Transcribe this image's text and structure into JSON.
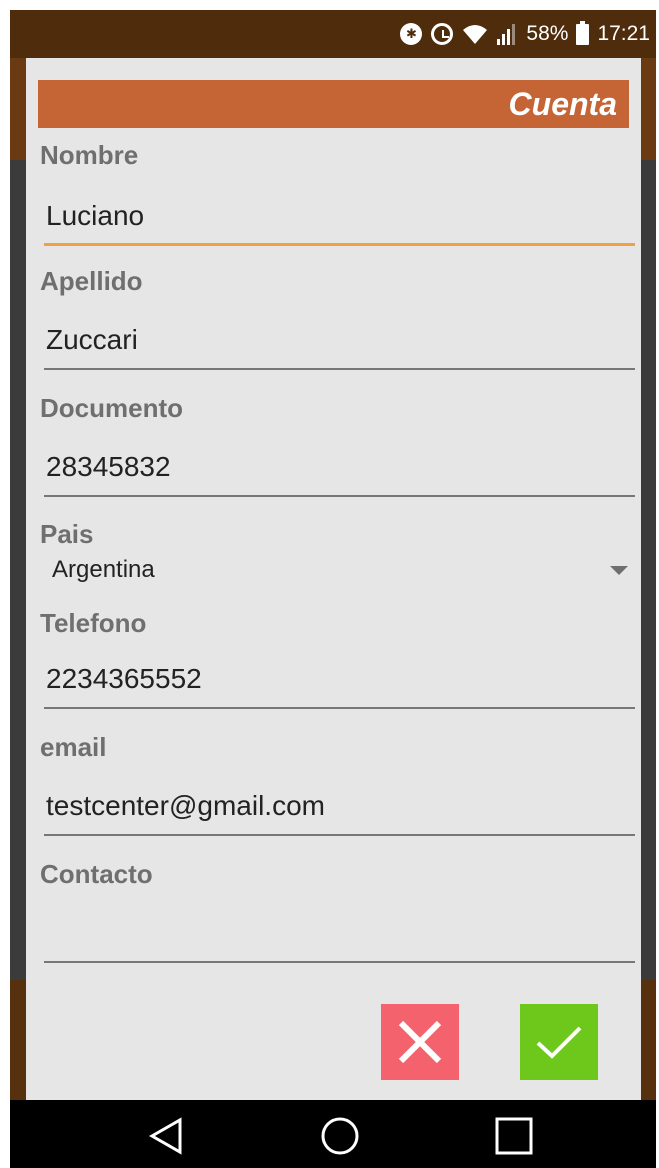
{
  "status_bar": {
    "icons": [
      "bluetooth-icon",
      "alarm-icon",
      "wifi-icon",
      "signal-icon",
      "battery-icon"
    ],
    "battery_percent": "58%",
    "time": "17:21"
  },
  "dialog": {
    "title": "Cuenta",
    "fields": {
      "nombre": {
        "label": "Nombre",
        "value": "Luciano"
      },
      "apellido": {
        "label": "Apellido",
        "value": "Zuccari"
      },
      "documento": {
        "label": "Documento",
        "value": "28345832"
      },
      "pais": {
        "label": "Pais",
        "value": "Argentina"
      },
      "telefono": {
        "label": "Telefono",
        "value": "2234365552"
      },
      "email": {
        "label": "email",
        "value": "testcenter@gmail.com"
      },
      "contacto": {
        "label": "Contacto",
        "value": ""
      }
    },
    "buttons": {
      "cancel_icon": "close-icon",
      "confirm_icon": "check-icon"
    }
  },
  "nav_bar": {
    "icons": [
      "back-icon",
      "home-icon",
      "recents-icon"
    ]
  },
  "colors": {
    "header": "#c56434",
    "focus_underline": "#f0a047",
    "cancel": "#f4636d",
    "confirm": "#6ec81c"
  }
}
